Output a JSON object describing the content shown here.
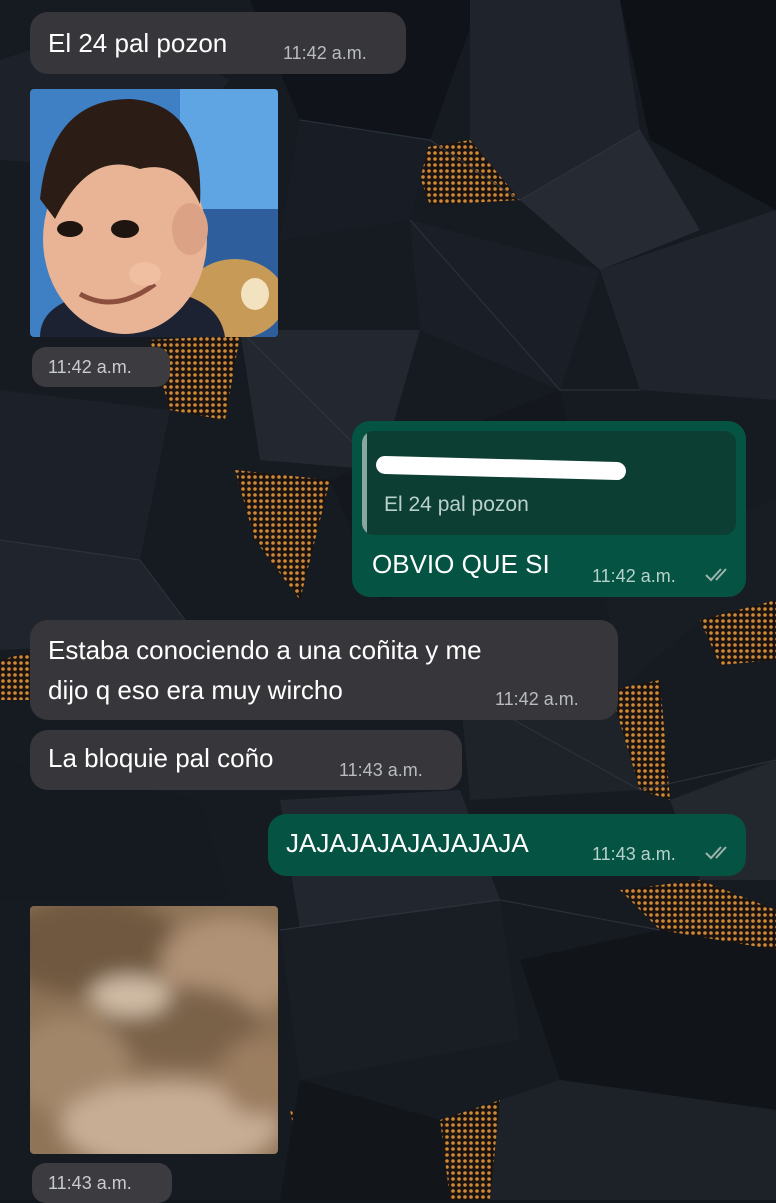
{
  "messages": [
    {
      "text": "El 24 pal pozon",
      "time": "11:42 a.m."
    },
    {
      "time": "11:42 a.m."
    },
    {
      "quote_text": "El 24 pal pozon",
      "text": "OBVIO QUE SI",
      "time": "11:42 a.m."
    },
    {
      "line1": "Estaba conociendo a una coñita y me",
      "line2": "dijo q eso era muy wircho",
      "time": "11:42 a.m."
    },
    {
      "text": "La bloquie pal coño",
      "time": "11:43 a.m."
    },
    {
      "text": "JAJAJAJAJAJAJAJA",
      "time": "11:43 a.m."
    },
    {
      "time": "11:43 a.m."
    }
  ],
  "colors": {
    "incoming_bubble": "#37373b",
    "outgoing_bubble": "#045343",
    "quote_bar": "#8aa6a0",
    "read_ticks": "#9fb3ae"
  },
  "icons": [
    "double-check-icon"
  ]
}
